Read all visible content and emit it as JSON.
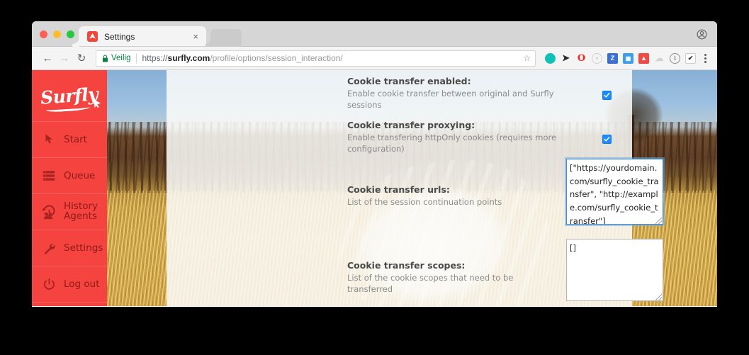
{
  "window": {
    "traffic_lights": [
      "close",
      "minimize",
      "maximize"
    ],
    "tab": {
      "title": "Settings",
      "close_label": "×",
      "favicon_name": "surfly-favicon"
    },
    "profile_icon": "account-icon"
  },
  "toolbar": {
    "back_glyph": "←",
    "forward_glyph": "→",
    "reload_glyph": "↻",
    "lock_glyph": "🔒",
    "secure_label": "Veilig",
    "url": {
      "scheme": "https://",
      "host": "surfly.com",
      "path": "/profile/options/session_interaction/",
      "full": "https://surfly.com/profile/options/session_interaction/"
    },
    "bookmark_glyph": "☆",
    "extensions": [
      {
        "name": "teal-blob-extension",
        "label": "",
        "color": "#0fc1b7",
        "shape": "circle"
      },
      {
        "name": "black-cursor-extension",
        "label": "",
        "color": "#2b2b2b",
        "shape": "glyph"
      },
      {
        "name": "opera-extension",
        "label": "O",
        "color": "#f4241e",
        "shape": "glyph"
      },
      {
        "name": "grey-circle-extension",
        "label": "",
        "color": "#c9c9c9",
        "shape": "circle"
      },
      {
        "name": "zotero-extension",
        "label": "Z",
        "color": "#3b6fd4",
        "shape": "square"
      },
      {
        "name": "blue-panel-extension",
        "label": "",
        "color": "#3f9ee8",
        "shape": "square"
      },
      {
        "name": "red-doc-extension",
        "label": "",
        "color": "#ef4b45",
        "shape": "square"
      },
      {
        "name": "cloud-extension",
        "label": "",
        "color": "#d3d3d3",
        "shape": "glyph"
      },
      {
        "name": "info-extension",
        "label": "i",
        "color": "#8d8d8d",
        "shape": "circle"
      },
      {
        "name": "checkmark-extension",
        "label": "✔",
        "color": "#3c3c3c",
        "shape": "square"
      }
    ],
    "menu_name": "chrome-menu"
  },
  "sidebar": {
    "brand": "Surfly",
    "brand_color": "#f5433f",
    "items": [
      {
        "label": "Start",
        "icon": "cursor-arrow-icon"
      },
      {
        "label": "Queue",
        "icon": "stacked-bars-icon"
      },
      {
        "label": "History",
        "icon": "history-clock-icon"
      },
      {
        "label": "Agents",
        "icon": "agents-people-icon"
      },
      {
        "label": "Settings",
        "icon": "wrench-icon"
      },
      {
        "label": "Log out",
        "icon": "power-icon"
      }
    ]
  },
  "form": {
    "fields": [
      {
        "label": "Cookie transfer enabled:",
        "help": "Enable cookie transfer between original and Surfly sessions",
        "control": "checkbox",
        "checked": true
      },
      {
        "label": "Cookie transfer proxying:",
        "help": "Enable transfering httpOnly cookies (requires more configuration)",
        "control": "checkbox",
        "checked": true
      },
      {
        "label": "Cookie transfer urls:",
        "help": "List of the session continuation points",
        "control": "textarea",
        "value": "[\"https://yourdomain.com/surfly_cookie_transfer\", \"http://example.com/surfly_cookie_transfer\"]",
        "focused": true
      },
      {
        "label": "Cookie transfer scopes:",
        "help": "List of the cookie scopes that need to be transferred",
        "control": "textarea",
        "value": "[]",
        "focused": false
      }
    ]
  }
}
